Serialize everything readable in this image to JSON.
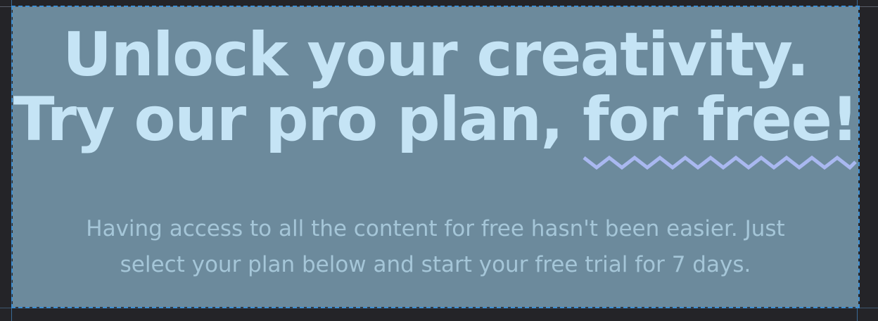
{
  "hero": {
    "headline_line1": "Unlock your creativity.",
    "headline_line2_prefix": "Try our pro plan, ",
    "headline_line2_highlight": "for free!",
    "subtitle": "Having access to all the content for free hasn't been easier. Just select your plan below and start your free trial for 7 days."
  },
  "colors": {
    "background": "#242428",
    "hero_background": "#6c8a9c",
    "headline": "#c5e4f5",
    "subtitle": "#a5c6d8",
    "squiggle": "#a9b8f0",
    "selection_outline": "#3d8fd4"
  },
  "icons": {
    "underline_decoration": "squiggle-underline-icon"
  }
}
